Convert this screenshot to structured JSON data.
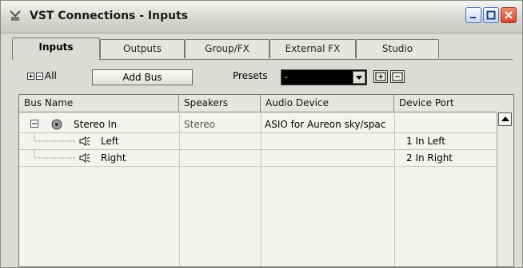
{
  "window": {
    "title": "VST Connections - Inputs"
  },
  "tabs": [
    {
      "label": "Inputs",
      "active": true
    },
    {
      "label": "Outputs",
      "active": false
    },
    {
      "label": "Group/FX",
      "active": false
    },
    {
      "label": "External FX",
      "active": false
    },
    {
      "label": "Studio",
      "active": false
    }
  ],
  "toolbar": {
    "all_label": "All",
    "add_bus_label": "Add Bus",
    "presets_label": "Presets",
    "presets_value": "-"
  },
  "table": {
    "columns": [
      "Bus Name",
      "Speakers",
      "Audio Device",
      "Device Port"
    ],
    "rows": [
      {
        "bus": "Stereo In",
        "speakers": "Stereo",
        "device": "ASIO for Aureon sky/spac",
        "port": ""
      },
      {
        "bus": "Left",
        "speakers": "",
        "device": "",
        "port": "1 In Left"
      },
      {
        "bus": "Right",
        "speakers": "",
        "device": "",
        "port": "2 In Right"
      }
    ]
  },
  "colors": {
    "close_button": "#d8452b",
    "accent": "#4a6fb5"
  }
}
